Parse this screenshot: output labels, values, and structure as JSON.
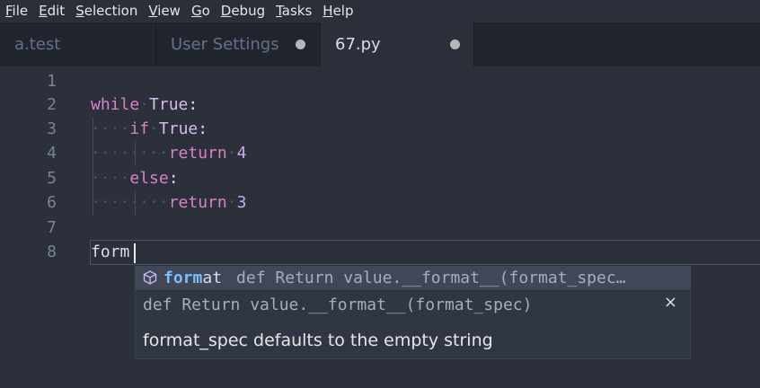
{
  "menu": {
    "items": [
      {
        "u": "F",
        "rest": "ile"
      },
      {
        "u": "E",
        "rest": "dit"
      },
      {
        "u": "S",
        "rest": "election"
      },
      {
        "u": "V",
        "rest": "iew"
      },
      {
        "u": "G",
        "rest": "o"
      },
      {
        "u": "D",
        "rest": "ebug"
      },
      {
        "u": "T",
        "rest": "asks"
      },
      {
        "u": "H",
        "rest": "elp"
      }
    ]
  },
  "tabs": [
    {
      "label": "a.test",
      "modified": false
    },
    {
      "label": "User Settings",
      "modified": true
    },
    {
      "label": "67.py",
      "modified": true,
      "active": true
    }
  ],
  "editor": {
    "line_numbers": [
      "1",
      "2",
      "3",
      "4",
      "5",
      "6",
      "7",
      "8"
    ],
    "lines": {
      "l2_kw": "while",
      "l2_const": "True",
      "l2_colon": ":",
      "l3_kw": "if",
      "l3_const": "True",
      "l3_colon": ":",
      "l4_kw": "return",
      "l4_num": "4",
      "l5_kw": "else",
      "l5_colon": ":",
      "l6_kw": "return",
      "l6_num": "3",
      "l8_text": "form"
    },
    "whitespace_dot": "·"
  },
  "autocomplete": {
    "icon": "cube-icon",
    "match": "form",
    "rest": "at",
    "detail": "def Return value.__format__(format_spec…",
    "doc_signature": "def Return value.__format__(format_spec)",
    "doc_text": "format_spec defaults to the empty string",
    "close": "×"
  },
  "colors": {
    "keyword": "#d981c7",
    "constant": "#d8b8f0",
    "number": "#c9a6f0",
    "match": "#79c0ff"
  }
}
